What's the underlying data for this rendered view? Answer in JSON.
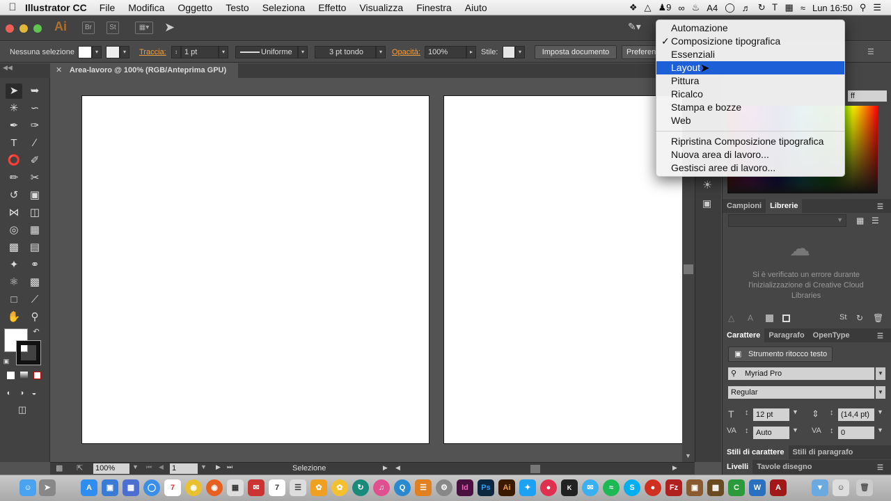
{
  "menubar": {
    "app_name": "Illustrator CC",
    "items": [
      "File",
      "Modifica",
      "Oggetto",
      "Testo",
      "Seleziona",
      "Effetto",
      "Visualizza",
      "Finestra",
      "Aiuto"
    ],
    "tray": {
      "badge1": "9",
      "badge2": "4",
      "clock": "Lun 16:50"
    }
  },
  "appbar": {
    "logo": "Ai",
    "icon_br": "Br",
    "icon_st": "St"
  },
  "control_bar": {
    "selection": "Nessuna selezione",
    "stroke_label": "Traccia:",
    "stroke_weight": "1 pt",
    "stroke_style": "Uniforme",
    "brush": "3 pt tondo",
    "opacity_label": "Opacità:",
    "opacity_value": "100%",
    "style_label": "Stile:",
    "setup_button": "Imposta documento",
    "prefs_button": "Preferen"
  },
  "document_tab": {
    "title": "Area-lavoro @ 100% (RGB/Anteprima GPU)"
  },
  "status_bar": {
    "zoom": "100%",
    "page": "1",
    "mode": "Selezione"
  },
  "workspace_menu": {
    "items": [
      {
        "label": "Automazione",
        "checked": false,
        "highlighted": false
      },
      {
        "label": "Composizione tipografica",
        "checked": true,
        "highlighted": false
      },
      {
        "label": "Essenziali",
        "checked": false,
        "highlighted": false
      },
      {
        "label": "Layout",
        "checked": false,
        "highlighted": true
      },
      {
        "label": "Pittura",
        "checked": false,
        "highlighted": false
      },
      {
        "label": "Ricalco",
        "checked": false,
        "highlighted": false
      },
      {
        "label": "Stampa e bozze",
        "checked": false,
        "highlighted": false
      },
      {
        "label": "Web",
        "checked": false,
        "highlighted": false
      }
    ],
    "actions": [
      "Ripristina Composizione tipografica",
      "Nuova area di lavoro...",
      "Gestisci aree di lavoro..."
    ],
    "check_glyph": "✓"
  },
  "right_panel": {
    "color_hex_fragment": "ff",
    "library_tabs": [
      "Campioni",
      "Librerie"
    ],
    "library_error": "Si è verificato un errore durante l'inizializzazione di Creative Cloud Libraries",
    "type_tabs": [
      "Carattere",
      "Paragrafo",
      "OpenType"
    ],
    "touch_type_button": "Strumento ritocco testo",
    "font_family": "Myriad Pro",
    "font_style": "Regular",
    "font_size": "12 pt",
    "leading": "(14,4 pt)",
    "kerning": "Auto",
    "tracking": "0",
    "style_tabs": [
      "Stili di carattere",
      "Stili di paragrafo"
    ],
    "layer_tabs": [
      "Livelli",
      "Tavole disegno"
    ]
  },
  "colors": {
    "menu_highlight": "#1d5fd6",
    "ui_dark": "#535353",
    "accent_orange": "#f0a040"
  }
}
